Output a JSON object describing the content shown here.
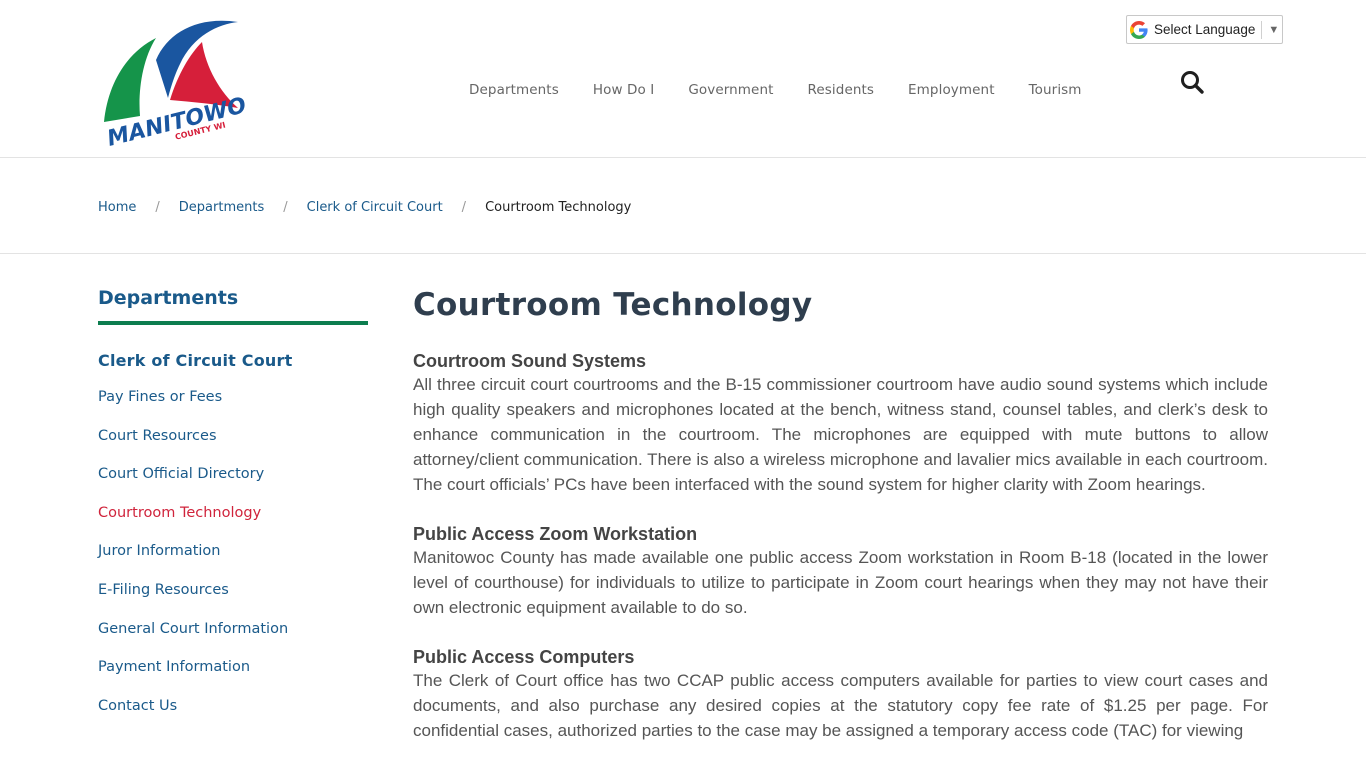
{
  "header": {
    "logo": {
      "name": "MANITOWOC",
      "sub": "COUNTY WI",
      "colors": {
        "blue": "#1a56a0",
        "green": "#15944a",
        "red": "#d61f3a"
      }
    },
    "nav": [
      "Departments",
      "How Do I",
      "Government",
      "Residents",
      "Employment",
      "Tourism"
    ],
    "search_icon": "search-icon",
    "language": {
      "label": "Select Language",
      "arrow": "▼",
      "icon": "google-g-icon"
    }
  },
  "breadcrumb": {
    "items": [
      "Home",
      "Departments",
      "Clerk of Circuit Court",
      "Courtroom Technology"
    ],
    "separator": "/"
  },
  "sidebar": {
    "title": "Departments",
    "subtitle": "Clerk of Circuit Court",
    "links": [
      "Pay Fines or Fees",
      "Court Resources",
      "Court Official Directory",
      "Courtroom Technology",
      "Juror Information",
      "E-Filing Resources",
      "General Court Information",
      "Payment Information",
      "Contact Us"
    ],
    "active_link": "Courtroom Technology"
  },
  "main": {
    "title": "Courtroom Technology",
    "sections": [
      {
        "heading": "Courtroom Sound Systems",
        "body": "All three circuit court courtrooms and the B-15 commissioner courtroom have audio sound systems which include high quality speakers and microphones located at the bench, witness stand, counsel tables, and clerk’s desk  to enhance communication in the courtroom.  The microphones are equipped with mute buttons to allow attorney/client communication.  There is also a wireless microphone and lavalier mics available in each courtroom.  The court officials’ PCs have been interfaced with the sound system for higher clarity with Zoom hearings."
      },
      {
        "heading": "Public Access Zoom Workstation",
        "body": "Manitowoc County has made available one public access Zoom workstation in Room B-18 (located in the lower level of courthouse) for individuals to utilize to participate in Zoom court hearings when they may not have their own electronic equipment available to do so."
      },
      {
        "heading": "Public Access Computers",
        "body": "The Clerk of Court office has two CCAP public access computers available for parties to view court cases and documents, and also purchase any desired copies at the statutory copy fee rate of $1.25 per page.  For confidential cases, authorized parties to the case may be assigned a temporary access code (TAC) for viewing"
      }
    ]
  },
  "colors": {
    "link": "#1a5a8a",
    "active": "#d0243c",
    "accent_rule": "#0d7d4f",
    "title": "#2f3e4e"
  }
}
